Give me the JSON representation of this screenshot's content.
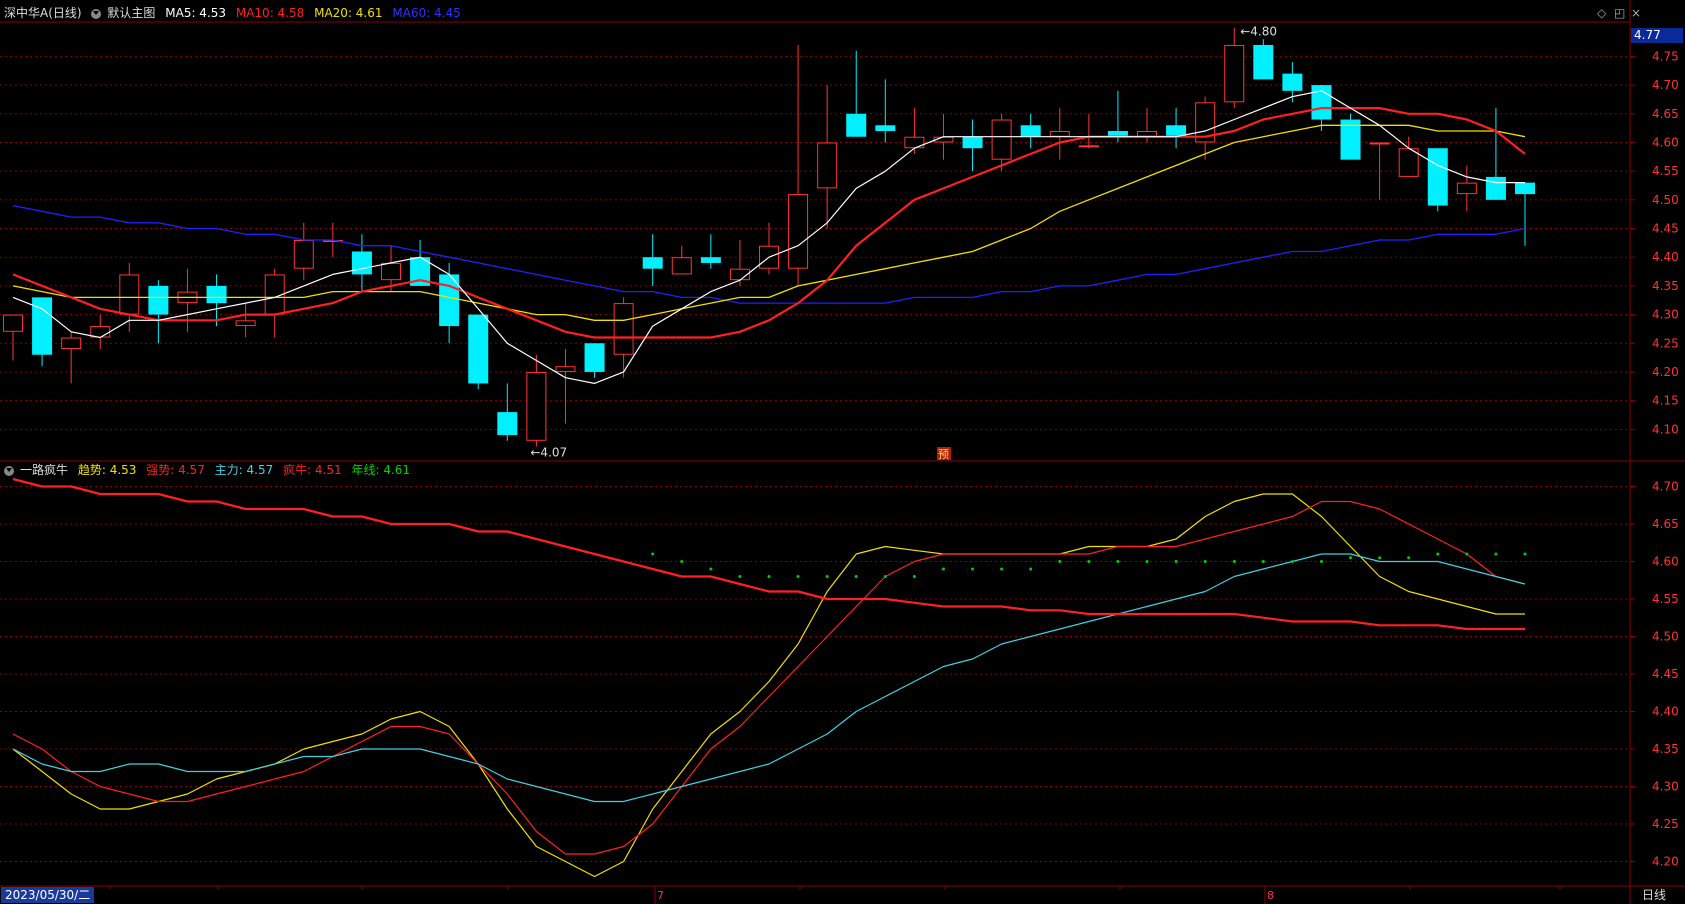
{
  "main_header": {
    "symbol": "深中华A(日线)",
    "template": "默认主图",
    "ma5": "MA5: 4.53",
    "ma10": "MA10: 4.58",
    "ma20": "MA20: 4.61",
    "ma60": "MA60: 4.45"
  },
  "indicator_header": {
    "name": "一路疯牛",
    "trend": "趋势: 4.53",
    "strong": "强势: 4.57",
    "main": "主力: 4.57",
    "bull": "疯牛: 4.51",
    "year": "年线: 4.61"
  },
  "footer": {
    "date": "2023/05/30/二",
    "period": "日线",
    "months": [
      "7",
      "8"
    ]
  },
  "price_tag": "4.77",
  "annotations": {
    "high": "4.80",
    "low": "4.07",
    "pre_marker": "预"
  },
  "colors": {
    "up": "#ff3333",
    "down": "#00f0ff",
    "ma5": "#ffffff",
    "ma10": "#ff2020",
    "ma20": "#f0e000",
    "ma60": "#2020ff",
    "grid": "#8b0000",
    "axis_text": "#ff3333",
    "trend": "#f0e000",
    "strong": "#ff2020",
    "main": "#40d0e0",
    "bull": "#ff2020",
    "year": "#00d000"
  },
  "icons": [
    "diamond-icon",
    "restore-icon",
    "close-icon",
    "collapse-icon"
  ],
  "chart_data": [
    {
      "type": "candlestick",
      "title": "深中华A(日线)",
      "ylim": [
        4.05,
        4.81
      ],
      "yticks": [
        4.1,
        4.15,
        4.2,
        4.25,
        4.3,
        4.35,
        4.4,
        4.45,
        4.5,
        4.55,
        4.6,
        4.65,
        4.7,
        4.75
      ],
      "ohlc": [
        [
          4.27,
          4.3,
          4.22,
          4.3
        ],
        [
          4.33,
          4.33,
          4.21,
          4.23
        ],
        [
          4.24,
          4.27,
          4.18,
          4.26
        ],
        [
          4.26,
          4.3,
          4.24,
          4.28
        ],
        [
          4.3,
          4.39,
          4.27,
          4.37
        ],
        [
          4.35,
          4.36,
          4.25,
          4.3
        ],
        [
          4.32,
          4.38,
          4.27,
          4.34
        ],
        [
          4.35,
          4.37,
          4.28,
          4.32
        ],
        [
          4.28,
          4.32,
          4.26,
          4.29
        ],
        [
          4.3,
          4.38,
          4.26,
          4.37
        ],
        [
          4.38,
          4.46,
          4.36,
          4.43
        ],
        [
          4.43,
          4.46,
          4.4,
          4.43
        ],
        [
          4.41,
          4.44,
          4.34,
          4.37
        ],
        [
          4.36,
          4.42,
          4.34,
          4.39
        ],
        [
          4.4,
          4.43,
          4.35,
          4.35
        ],
        [
          4.37,
          4.39,
          4.25,
          4.28
        ],
        [
          4.3,
          4.3,
          4.17,
          4.18
        ],
        [
          4.13,
          4.18,
          4.08,
          4.09
        ],
        [
          4.08,
          4.23,
          4.07,
          4.2
        ],
        [
          4.2,
          4.24,
          4.11,
          4.21
        ],
        [
          4.25,
          4.25,
          4.19,
          4.2
        ],
        [
          4.23,
          4.33,
          4.19,
          4.32
        ],
        [
          4.4,
          4.44,
          4.35,
          4.38
        ],
        [
          4.37,
          4.42,
          4.37,
          4.4
        ],
        [
          4.4,
          4.44,
          4.38,
          4.39
        ],
        [
          4.36,
          4.43,
          4.35,
          4.38
        ],
        [
          4.38,
          4.46,
          4.37,
          4.42
        ],
        [
          4.38,
          4.77,
          4.35,
          4.51
        ],
        [
          4.52,
          4.7,
          4.45,
          4.6
        ],
        [
          4.65,
          4.76,
          4.61,
          4.61
        ],
        [
          4.63,
          4.71,
          4.6,
          4.62
        ],
        [
          4.59,
          4.66,
          4.58,
          4.61
        ],
        [
          4.6,
          4.65,
          4.57,
          4.61
        ],
        [
          4.61,
          4.64,
          4.55,
          4.59
        ],
        [
          4.57,
          4.65,
          4.55,
          4.64
        ],
        [
          4.63,
          4.65,
          4.59,
          4.61
        ],
        [
          4.61,
          4.66,
          4.57,
          4.62
        ],
        [
          4.595,
          4.65,
          4.59,
          4.595
        ],
        [
          4.62,
          4.69,
          4.6,
          4.61
        ],
        [
          4.61,
          4.66,
          4.6,
          4.62
        ],
        [
          4.63,
          4.66,
          4.59,
          4.61
        ],
        [
          4.6,
          4.68,
          4.57,
          4.67
        ],
        [
          4.67,
          4.8,
          4.66,
          4.77
        ],
        [
          4.77,
          4.78,
          4.71,
          4.71
        ],
        [
          4.72,
          4.74,
          4.67,
          4.69
        ],
        [
          4.7,
          4.7,
          4.62,
          4.64
        ],
        [
          4.64,
          4.65,
          4.57,
          4.57
        ],
        [
          4.6,
          4.6,
          4.5,
          4.6
        ],
        [
          4.54,
          4.61,
          4.54,
          4.59
        ],
        [
          4.59,
          4.59,
          4.48,
          4.49
        ],
        [
          4.51,
          4.56,
          4.48,
          4.53
        ],
        [
          4.54,
          4.66,
          4.5,
          4.5
        ],
        [
          4.53,
          4.53,
          4.42,
          4.51
        ]
      ],
      "ma5": [
        4.33,
        4.31,
        4.27,
        4.26,
        4.29,
        4.29,
        4.3,
        4.31,
        4.32,
        4.33,
        4.35,
        4.37,
        4.38,
        4.39,
        4.4,
        4.37,
        4.31,
        4.25,
        4.22,
        4.19,
        4.18,
        4.2,
        4.28,
        4.31,
        4.34,
        4.36,
        4.4,
        4.42,
        4.46,
        4.52,
        4.55,
        4.59,
        4.61,
        4.61,
        4.61,
        4.61,
        4.61,
        4.61,
        4.61,
        4.61,
        4.61,
        4.62,
        4.64,
        4.66,
        4.68,
        4.69,
        4.66,
        4.63,
        4.59,
        4.56,
        4.54,
        4.53,
        4.53
      ],
      "ma10": [
        4.37,
        4.35,
        4.33,
        4.31,
        4.3,
        4.29,
        4.29,
        4.29,
        4.3,
        4.3,
        4.31,
        4.32,
        4.34,
        4.35,
        4.36,
        4.35,
        4.33,
        4.31,
        4.29,
        4.27,
        4.26,
        4.26,
        4.26,
        4.26,
        4.26,
        4.27,
        4.29,
        4.32,
        4.36,
        4.42,
        4.46,
        4.5,
        4.52,
        4.54,
        4.56,
        4.58,
        4.6,
        4.61,
        4.61,
        4.61,
        4.61,
        4.61,
        4.62,
        4.64,
        4.65,
        4.66,
        4.66,
        4.66,
        4.65,
        4.65,
        4.64,
        4.62,
        4.58
      ],
      "ma20": [
        4.35,
        4.34,
        4.33,
        4.33,
        4.33,
        4.33,
        4.33,
        4.33,
        4.33,
        4.33,
        4.33,
        4.34,
        4.34,
        4.34,
        4.34,
        4.33,
        4.32,
        4.31,
        4.3,
        4.3,
        4.29,
        4.29,
        4.3,
        4.31,
        4.32,
        4.33,
        4.33,
        4.35,
        4.36,
        4.37,
        4.38,
        4.39,
        4.4,
        4.41,
        4.43,
        4.45,
        4.48,
        4.5,
        4.52,
        4.54,
        4.56,
        4.58,
        4.6,
        4.61,
        4.62,
        4.63,
        4.63,
        4.63,
        4.63,
        4.62,
        4.62,
        4.62,
        4.61
      ],
      "ma60": [
        4.49,
        4.48,
        4.47,
        4.47,
        4.46,
        4.46,
        4.45,
        4.45,
        4.44,
        4.44,
        4.43,
        4.43,
        4.42,
        4.42,
        4.41,
        4.4,
        4.39,
        4.38,
        4.37,
        4.36,
        4.35,
        4.34,
        4.34,
        4.33,
        4.33,
        4.32,
        4.32,
        4.32,
        4.32,
        4.32,
        4.32,
        4.33,
        4.33,
        4.33,
        4.34,
        4.34,
        4.35,
        4.35,
        4.36,
        4.37,
        4.37,
        4.38,
        4.39,
        4.4,
        4.41,
        4.41,
        4.42,
        4.43,
        4.43,
        4.44,
        4.44,
        4.44,
        4.45
      ]
    },
    {
      "type": "line",
      "title": "一路疯牛",
      "ylim": [
        4.17,
        4.73
      ],
      "yticks": [
        4.2,
        4.25,
        4.3,
        4.35,
        4.4,
        4.45,
        4.5,
        4.55,
        4.6,
        4.65,
        4.7
      ],
      "series": [
        {
          "name": "趋势",
          "values": [
            4.35,
            4.32,
            4.29,
            4.27,
            4.27,
            4.28,
            4.29,
            4.31,
            4.32,
            4.33,
            4.35,
            4.36,
            4.37,
            4.39,
            4.4,
            4.38,
            4.33,
            4.27,
            4.22,
            4.2,
            4.18,
            4.2,
            4.27,
            4.32,
            4.37,
            4.4,
            4.44,
            4.49,
            4.56,
            4.61,
            4.62,
            4.615,
            4.61,
            4.61,
            4.61,
            4.61,
            4.61,
            4.62,
            4.62,
            4.62,
            4.63,
            4.66,
            4.68,
            4.69,
            4.69,
            4.66,
            4.62,
            4.58,
            4.56,
            4.55,
            4.54,
            4.53,
            4.53
          ]
        },
        {
          "name": "强势",
          "values": [
            4.37,
            4.35,
            4.32,
            4.3,
            4.29,
            4.28,
            4.28,
            4.29,
            4.3,
            4.31,
            4.32,
            4.34,
            4.36,
            4.38,
            4.38,
            4.37,
            4.33,
            4.29,
            4.24,
            4.21,
            4.21,
            4.22,
            4.25,
            4.3,
            4.35,
            4.38,
            4.42,
            4.46,
            4.5,
            4.54,
            4.58,
            4.6,
            4.61,
            4.61,
            4.61,
            4.61,
            4.61,
            4.61,
            4.62,
            4.62,
            4.62,
            4.63,
            4.64,
            4.65,
            4.66,
            4.68,
            4.68,
            4.67,
            4.65,
            4.63,
            4.61,
            4.58,
            4.57
          ]
        },
        {
          "name": "主力",
          "values": [
            4.35,
            4.33,
            4.32,
            4.32,
            4.33,
            4.33,
            4.32,
            4.32,
            4.32,
            4.33,
            4.34,
            4.34,
            4.35,
            4.35,
            4.35,
            4.34,
            4.33,
            4.31,
            4.3,
            4.29,
            4.28,
            4.28,
            4.29,
            4.3,
            4.31,
            4.32,
            4.33,
            4.35,
            4.37,
            4.4,
            4.42,
            4.44,
            4.46,
            4.47,
            4.49,
            4.5,
            4.51,
            4.52,
            4.53,
            4.54,
            4.55,
            4.56,
            4.58,
            4.59,
            4.6,
            4.61,
            4.61,
            4.6,
            4.6,
            4.6,
            4.59,
            4.58,
            4.57
          ]
        },
        {
          "name": "疯牛",
          "values": [
            4.71,
            4.7,
            4.7,
            4.69,
            4.69,
            4.69,
            4.68,
            4.68,
            4.67,
            4.67,
            4.67,
            4.66,
            4.66,
            4.65,
            4.65,
            4.65,
            4.64,
            4.64,
            4.63,
            4.62,
            4.61,
            4.6,
            4.59,
            4.58,
            4.58,
            4.57,
            4.56,
            4.56,
            4.55,
            4.55,
            4.55,
            4.545,
            4.54,
            4.54,
            4.54,
            4.535,
            4.535,
            4.53,
            4.53,
            4.53,
            4.53,
            4.53,
            4.53,
            4.525,
            4.52,
            4.52,
            4.52,
            4.515,
            4.515,
            4.515,
            4.51,
            4.51,
            4.51
          ]
        },
        {
          "name": "年线",
          "values": [
            null,
            null,
            null,
            null,
            null,
            null,
            null,
            null,
            null,
            null,
            null,
            null,
            null,
            null,
            null,
            null,
            null,
            null,
            null,
            null,
            null,
            null,
            4.61,
            4.6,
            4.59,
            4.58,
            4.58,
            4.58,
            4.58,
            4.58,
            4.58,
            4.58,
            4.59,
            4.59,
            4.59,
            4.59,
            4.6,
            4.6,
            4.6,
            4.6,
            4.6,
            4.6,
            4.6,
            4.6,
            4.6,
            4.6,
            4.605,
            4.605,
            4.605,
            4.61,
            4.61,
            4.61,
            4.61
          ]
        }
      ]
    }
  ]
}
